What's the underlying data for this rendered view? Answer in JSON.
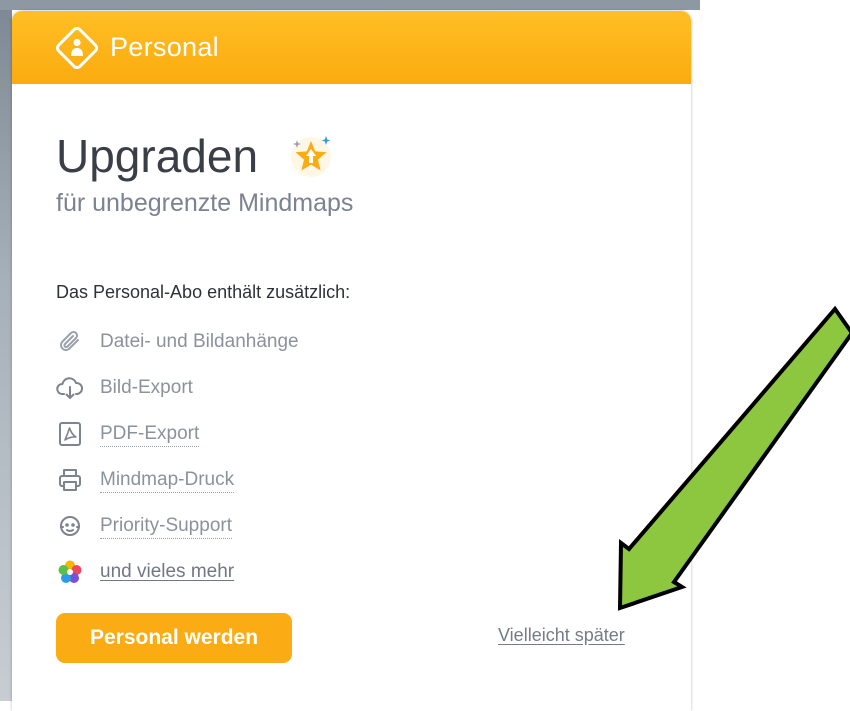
{
  "header": {
    "title": "Personal",
    "badge_icon": "person-diamond-icon",
    "gradient": [
      "#ffbf24",
      "#fbab0f"
    ]
  },
  "main": {
    "title": "Upgraden",
    "title_icon": "star-upgrade-icon",
    "subtitle": "für unbegrenzte Mindmaps",
    "features_heading": "Das Personal-Abo enthält zusätzlich:",
    "features": [
      {
        "label": "Datei- und Bildanhänge",
        "icon": "paperclip-icon"
      },
      {
        "label": "Bild-Export",
        "icon": "cloud-download-icon"
      },
      {
        "label": "PDF-Export",
        "icon": "pdf-icon"
      },
      {
        "label": "Mindmap-Druck",
        "icon": "printer-icon"
      },
      {
        "label": "Priority-Support",
        "icon": "support-headset-icon"
      },
      {
        "label": "und vieles mehr",
        "icon": "colorful-flower-icon"
      }
    ]
  },
  "actions": {
    "primary_label": "Personal werden",
    "secondary_label": "Vielleicht später"
  },
  "colors": {
    "accent": "#fbab13",
    "title_text": "#3a3f47",
    "muted_text": "#8b929c",
    "annotation_arrow": "#8dc63f"
  },
  "annotation": {
    "icon": "green-arrow-icon",
    "points_to": "Vielleicht später"
  }
}
